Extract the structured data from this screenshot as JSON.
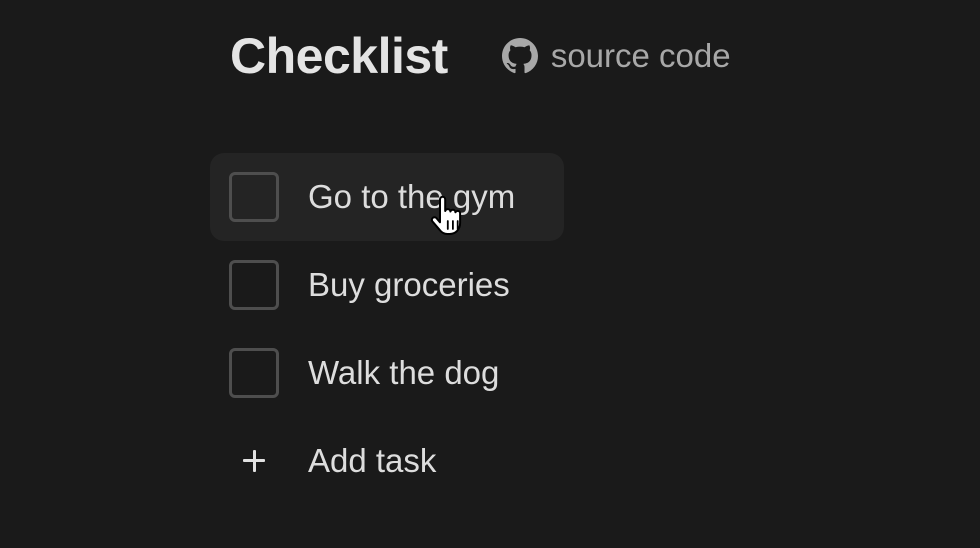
{
  "header": {
    "title": "Checklist",
    "source_link_label": "source code",
    "source_link_icon": "github-icon"
  },
  "tasks": [
    {
      "label": "Go to the gym",
      "checked": false,
      "hovered": true
    },
    {
      "label": "Buy groceries",
      "checked": false,
      "hovered": false
    },
    {
      "label": "Walk the dog",
      "checked": false,
      "hovered": false
    }
  ],
  "add_task": {
    "label": "Add task",
    "icon": "plus-icon"
  },
  "colors": {
    "background": "#1a1a1a",
    "hover_background": "#242424",
    "text": "#dddddd",
    "muted_text": "#a8a8a8",
    "checkbox_border": "#4e4e4e"
  }
}
